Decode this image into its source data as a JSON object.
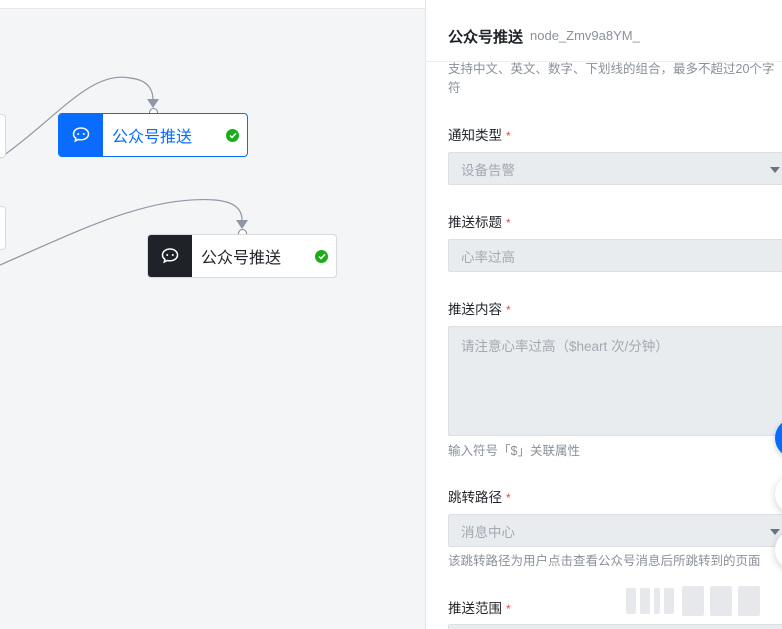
{
  "canvas": {
    "nodes": [
      {
        "label": "公众号推送",
        "icon": "wechat-icon",
        "state": "selected"
      },
      {
        "label": "公众号推送",
        "icon": "wechat-icon",
        "state": "normal"
      }
    ]
  },
  "panel": {
    "title": "公众号推送",
    "node_id": "node_Zmv9a8YM_",
    "name_hint_line1": "支持中文、英文、数字、下划线的组合，最多不超过20个字",
    "name_hint_line2": "符",
    "fields": {
      "notify_type": {
        "label": "通知类型",
        "value": "设备告警"
      },
      "push_title": {
        "label": "推送标题",
        "placeholder": "心率过高"
      },
      "push_content": {
        "label": "推送内容",
        "placeholder": "请注意心率过高（$heart 次/分钟）",
        "hint": "输入符号「$」关联属性"
      },
      "jump_path": {
        "label": "跳转路径",
        "value": "消息中心",
        "hint": "该跳转路径为用户点击查看公众号消息后所跳转到的页面"
      },
      "push_scope": {
        "label": "推送范围"
      }
    },
    "required_mark": "*"
  },
  "colors": {
    "accent": "#0a6cff",
    "success": "#1aad19",
    "required": "#e5484d"
  }
}
